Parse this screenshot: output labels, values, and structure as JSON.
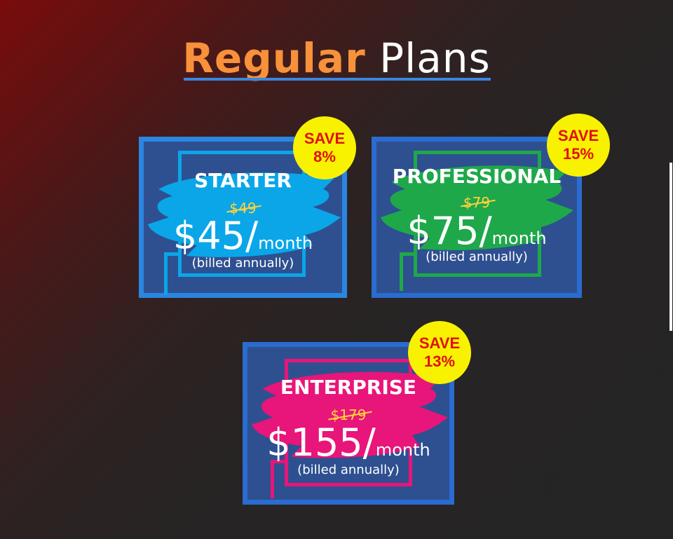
{
  "heading": {
    "accent": "Regular",
    "rest": "Plans"
  },
  "plans": [
    {
      "name": "STARTER",
      "old_price": "$49",
      "price": "$45/",
      "period": "month",
      "billing": "(billed annually)",
      "save_line1": "SAVE",
      "save_line2": "8%",
      "color": "#0aa6e8"
    },
    {
      "name": "PROFESSIONAL",
      "old_price": "$79",
      "price": "$75/",
      "period": "month",
      "billing": "(billed annually)",
      "save_line1": "SAVE",
      "save_line2": "15%",
      "color": "#1ea84a"
    },
    {
      "name": "ENTERPRISE",
      "old_price": "$179",
      "price": "$155/",
      "period": "month",
      "billing": "(billed annually)",
      "save_line1": "SAVE",
      "save_line2": "13%",
      "color": "#e8157a"
    }
  ],
  "colors": {
    "accent": "#f7913a",
    "card_bg": "#2e5090",
    "badge": "#f8f200",
    "badge_text": "#e01010"
  }
}
